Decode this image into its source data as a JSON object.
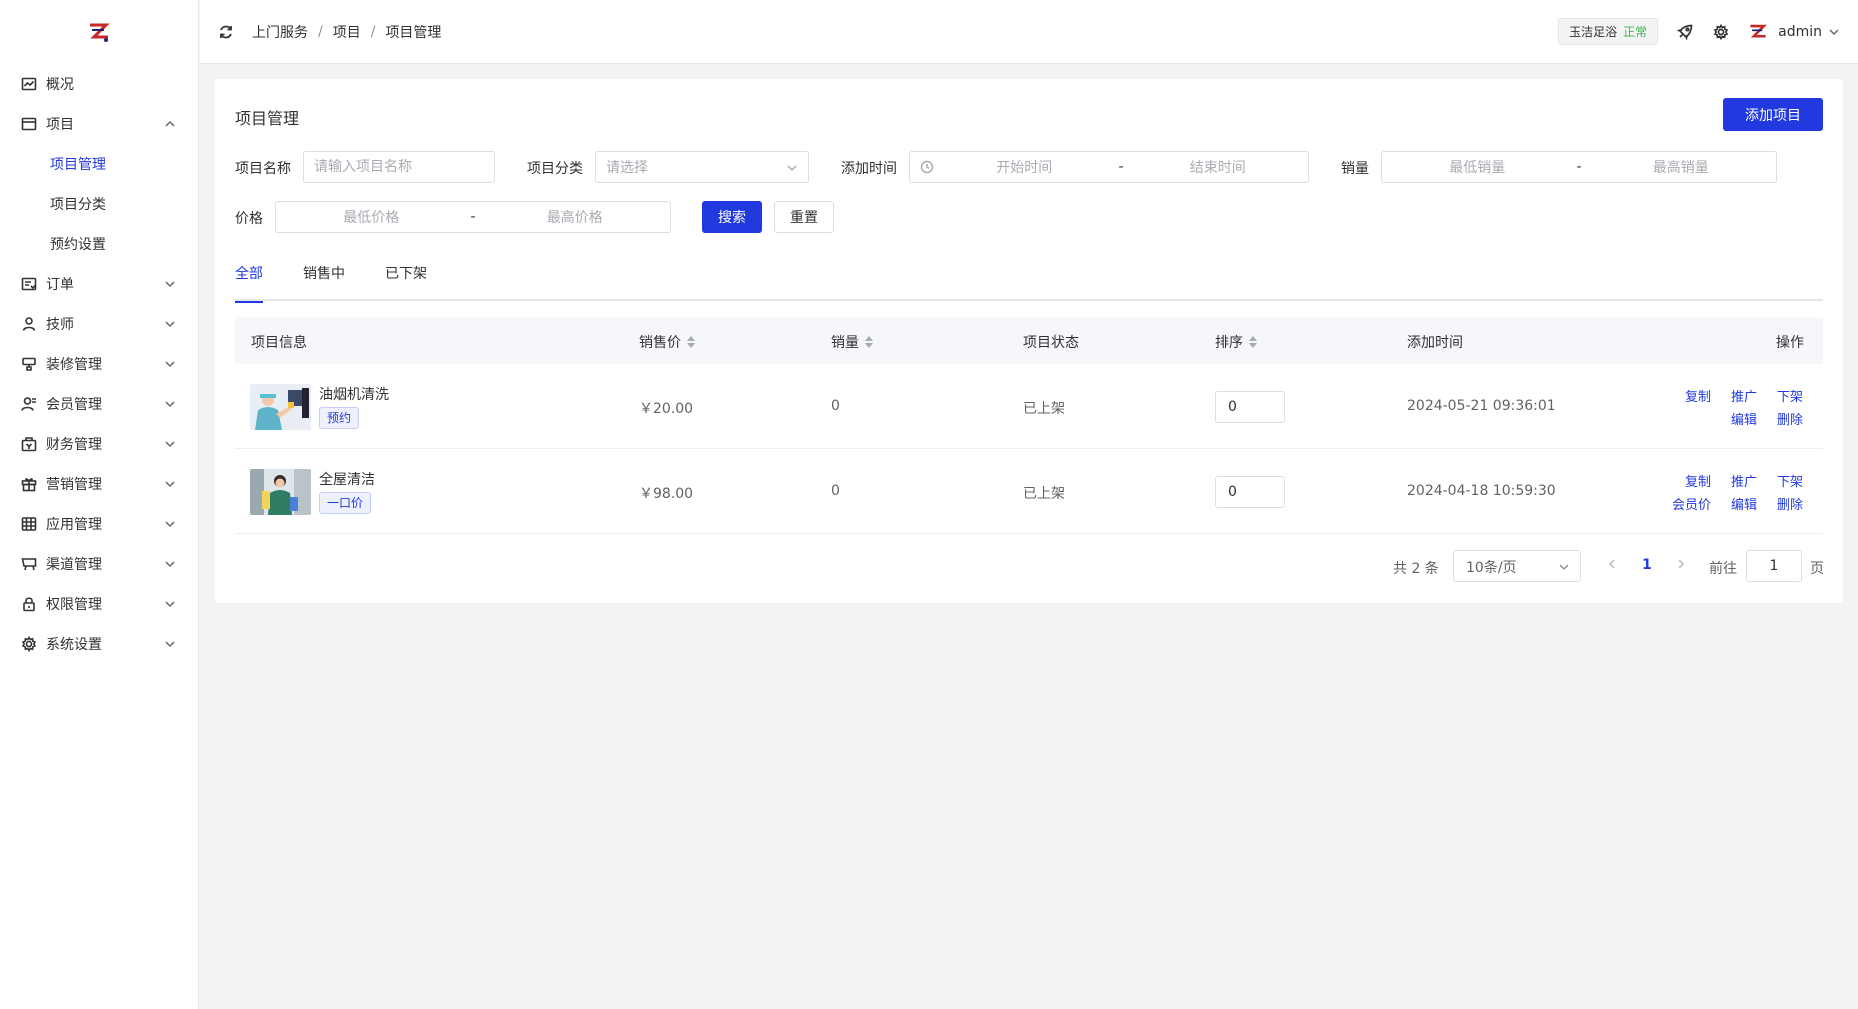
{
  "brand": {
    "logo_icon": "brand-logo-icon",
    "accent": "#2239e0"
  },
  "sidebar": {
    "items": [
      {
        "label": "概况",
        "icon": "chart-icon",
        "expandable": false
      },
      {
        "label": "项目",
        "icon": "card-icon",
        "expandable": true,
        "expanded": true,
        "children": [
          {
            "label": "项目管理",
            "active": true
          },
          {
            "label": "项目分类",
            "active": false
          },
          {
            "label": "预约设置",
            "active": false
          }
        ]
      },
      {
        "label": "订单",
        "icon": "order-icon",
        "expandable": true
      },
      {
        "label": "技师",
        "icon": "user-icon",
        "expandable": true
      },
      {
        "label": "装修管理",
        "icon": "brush-icon",
        "expandable": true
      },
      {
        "label": "会员管理",
        "icon": "member-icon",
        "expandable": true
      },
      {
        "label": "财务管理",
        "icon": "finance-icon",
        "expandable": true
      },
      {
        "label": "营销管理",
        "icon": "gift-icon",
        "expandable": true
      },
      {
        "label": "应用管理",
        "icon": "grid-icon",
        "expandable": true
      },
      {
        "label": "渠道管理",
        "icon": "cart-icon",
        "expandable": true
      },
      {
        "label": "权限管理",
        "icon": "lock-icon",
        "expandable": true
      },
      {
        "label": "系统设置",
        "icon": "gear-icon",
        "expandable": true
      }
    ]
  },
  "header": {
    "breadcrumb": [
      "上门服务",
      "项目",
      "项目管理"
    ],
    "shop_name": "玉洁足浴",
    "shop_status": "正常",
    "shop_status_color": "#3bb54a",
    "username": "admin"
  },
  "main": {
    "title": "项目管理",
    "add_button": "添加项目",
    "filters": {
      "name_label": "项目名称",
      "name_placeholder": "请输入项目名称",
      "category_label": "项目分类",
      "category_placeholder": "请选择",
      "time_label": "添加时间",
      "time_start": "开始时间",
      "time_end": "结束时间",
      "sales_label": "销量",
      "sales_min": "最低销量",
      "sales_max": "最高销量",
      "price_label": "价格",
      "price_min": "最低价格",
      "price_max": "最高价格",
      "range_sep": "-",
      "search_button": "搜索",
      "reset_button": "重置"
    },
    "tabs": [
      {
        "label": "全部",
        "active": true
      },
      {
        "label": "销售中",
        "active": false
      },
      {
        "label": "已下架",
        "active": false
      }
    ],
    "table": {
      "columns": [
        "项目信息",
        "销售价",
        "销量",
        "项目状态",
        "排序",
        "添加时间",
        "操作"
      ],
      "rows": [
        {
          "name": "油烟机清洗",
          "tag": "预约",
          "price": "￥20.00",
          "sales": "0",
          "status": "已上架",
          "sort": "0",
          "time": "2024-05-21 09:36:01",
          "actions": [
            "复制",
            "推广",
            "下架",
            "编辑",
            "删除"
          ]
        },
        {
          "name": "全屋清洁",
          "tag": "一口价",
          "price": "￥98.00",
          "sales": "0",
          "status": "已上架",
          "sort": "0",
          "time": "2024-04-18 10:59:30",
          "actions": [
            "复制",
            "推广",
            "下架",
            "会员价",
            "编辑",
            "删除"
          ]
        }
      ]
    },
    "pagination": {
      "total": "共 2 条",
      "page_size": "10条/页",
      "current_page": "1",
      "goto_label": "前往",
      "goto_value": "1",
      "page_unit": "页"
    }
  }
}
